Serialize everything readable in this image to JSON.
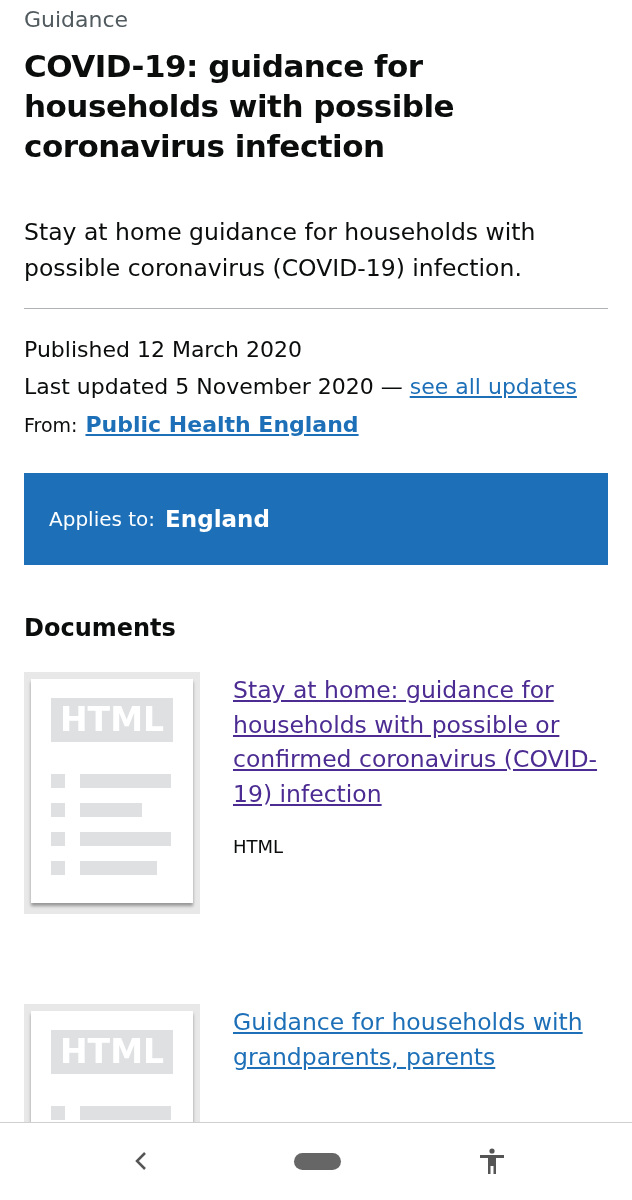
{
  "caption": "Guidance",
  "title": "COVID-19: guidance for households with possible coronavirus infection",
  "lead": "Stay at home guidance for households with possible coronavirus (COVID-19) infection.",
  "metadata": {
    "published": "Published 12 March 2020",
    "last_updated": "Last updated 5 November 2020 —",
    "updates_link": "see all updates",
    "from_label": "From:",
    "from_link": "Public Health England"
  },
  "applies_to": {
    "label": "Applies to:",
    "value": "England"
  },
  "documents_heading": "Documents",
  "documents": [
    {
      "thumbnail_label": "HTML",
      "title": "Stay at home: guidance for households with possible or confirmed coronavirus (COVID-19) infection",
      "format": "HTML",
      "visited": true
    },
    {
      "thumbnail_label": "HTML",
      "title": "Guidance for households with grandparents, parents",
      "visited": false
    }
  ]
}
